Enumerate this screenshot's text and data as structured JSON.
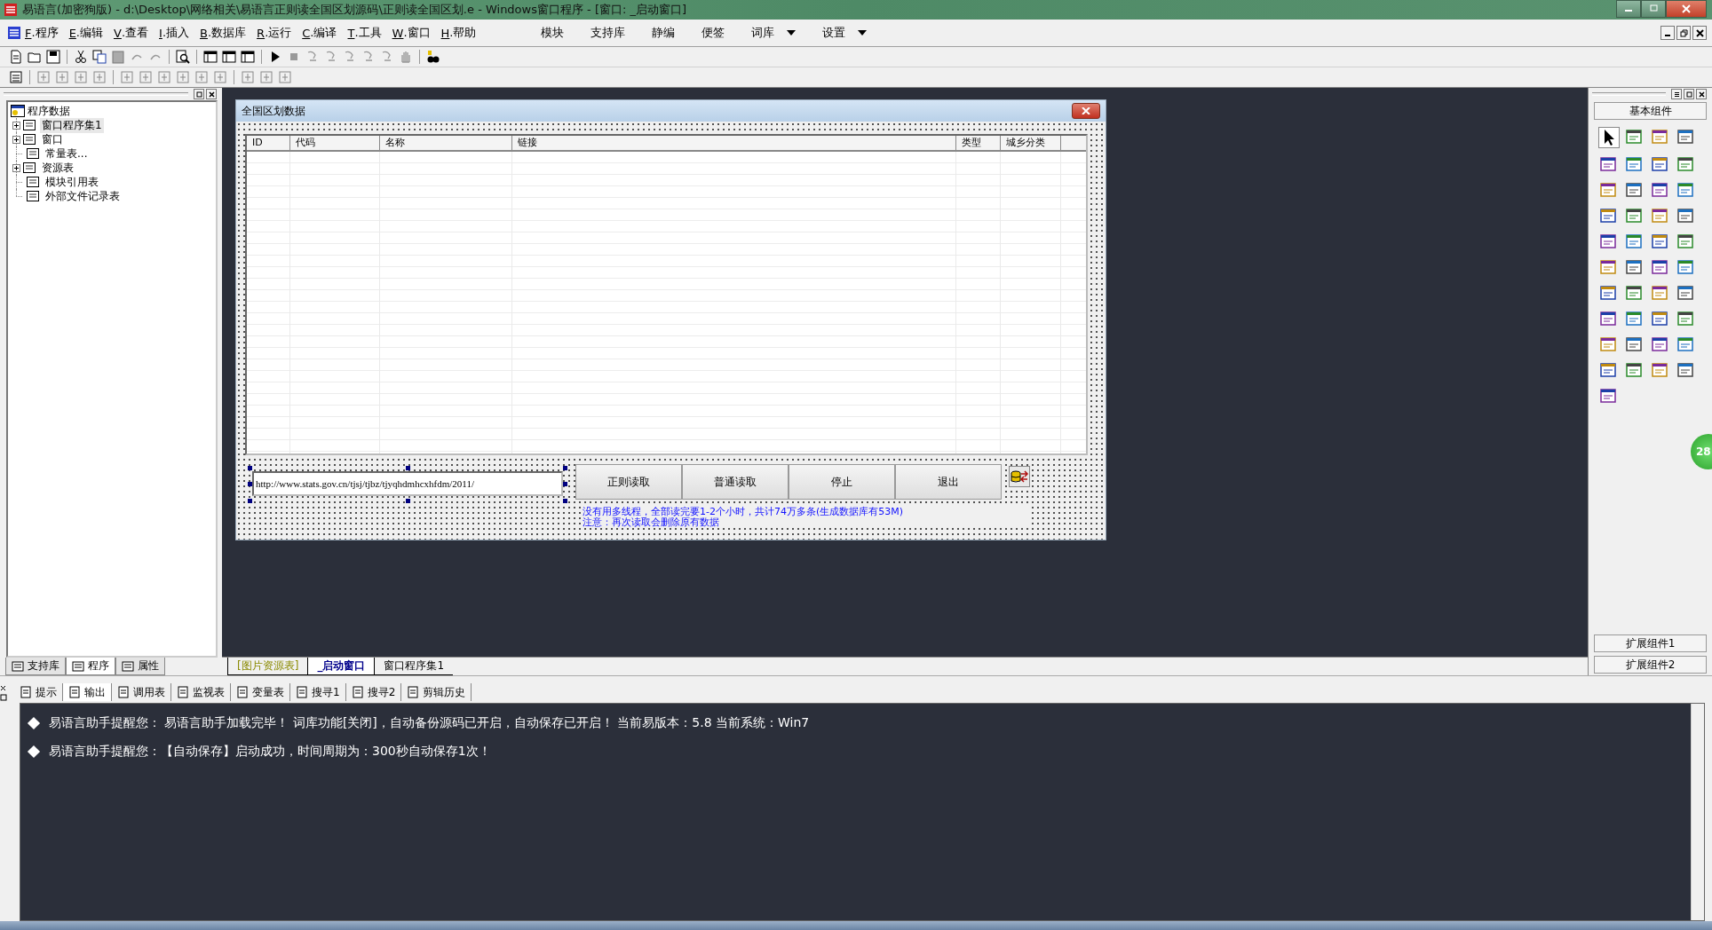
{
  "window": {
    "title": "易语言(加密狗版) - d:\\Desktop\\网络相关\\易语言正则读全国区划源码\\正则读全国区划.e - Windows窗口程序 - [窗口: _启动窗口]"
  },
  "menu": [
    {
      "key": "F",
      "label": ".程序"
    },
    {
      "key": "E",
      "label": ".编辑"
    },
    {
      "key": "V",
      "label": ".查看"
    },
    {
      "key": "I",
      "label": ".插入"
    },
    {
      "key": "B",
      "label": ".数据库"
    },
    {
      "key": "R",
      "label": ".运行"
    },
    {
      "key": "C",
      "label": ".编译"
    },
    {
      "key": "T",
      "label": ".工具"
    },
    {
      "key": "W",
      "label": ".窗口"
    },
    {
      "key": "H",
      "label": ".帮助"
    }
  ],
  "extra_menu": [
    {
      "label": "模块",
      "dropdown": false
    },
    {
      "label": "支持库",
      "dropdown": false
    },
    {
      "label": "静编",
      "dropdown": false
    },
    {
      "label": "便签",
      "dropdown": false
    },
    {
      "label": "词库",
      "dropdown": true
    },
    {
      "label": "设置",
      "dropdown": true
    }
  ],
  "tree": {
    "root": "程序数据",
    "children": [
      {
        "label": "窗口程序集1",
        "kind": "folder",
        "selected": true
      },
      {
        "label": "窗口",
        "kind": "folder",
        "selected": false
      },
      {
        "label": "常量表...",
        "kind": "leaf",
        "selected": false
      },
      {
        "label": "资源表",
        "kind": "folder",
        "selected": false
      },
      {
        "label": "模块引用表",
        "kind": "leaf",
        "selected": false
      },
      {
        "label": "外部文件记录表",
        "kind": "leaf",
        "selected": false
      }
    ]
  },
  "left_tabs": [
    {
      "label": "支持库",
      "selected": false
    },
    {
      "label": "程序",
      "selected": true
    },
    {
      "label": "属性",
      "selected": false
    }
  ],
  "editor_tabs": [
    {
      "label": "[图片资源表]",
      "kind": "resource",
      "selected": false
    },
    {
      "label": "_启动窗口",
      "kind": "window",
      "selected": true
    },
    {
      "label": "窗口程序集1",
      "kind": "code",
      "selected": false
    }
  ],
  "form": {
    "title": "全国区划数据",
    "table": {
      "columns": [
        "ID",
        "代码",
        "名称",
        "链接",
        "类型",
        "城乡分类"
      ]
    },
    "url_field": {
      "value": "http://www.stats.gov.cn/tjsj/tjbz/tjyqhdmhcxhfdm/2011/"
    },
    "buttons": [
      "正则读取",
      "普通读取",
      "停止",
      "退出"
    ],
    "notes": [
      "没有用多线程，全部读完要1-2个小时，共计74万多条(生成数据库有53M)",
      "注意：再次读取会删除原有数据"
    ]
  },
  "components": {
    "header": "基本组件",
    "footer_buttons": [
      "扩展组件1",
      "扩展组件2"
    ]
  },
  "float_badge": "28",
  "output_tabs": [
    {
      "label": "提示",
      "selected": false
    },
    {
      "label": "输出",
      "selected": true
    },
    {
      "label": "调用表",
      "selected": false
    },
    {
      "label": "监视表",
      "selected": false
    },
    {
      "label": "变量表",
      "selected": false
    },
    {
      "label": "搜寻1",
      "selected": false
    },
    {
      "label": "搜寻2",
      "selected": false
    },
    {
      "label": "剪辑历史",
      "selected": false
    }
  ],
  "output_lines": [
    "易语言助手提醒您：  易语言助手加载完毕！  词库功能[关闭]，自动备份源码已开启，自动保存已开启！  当前易版本：5.8  当前系统：Win7",
    "易语言助手提醒您：【自动保存】启动成功，时间周期为：300秒自动保存1次！"
  ]
}
